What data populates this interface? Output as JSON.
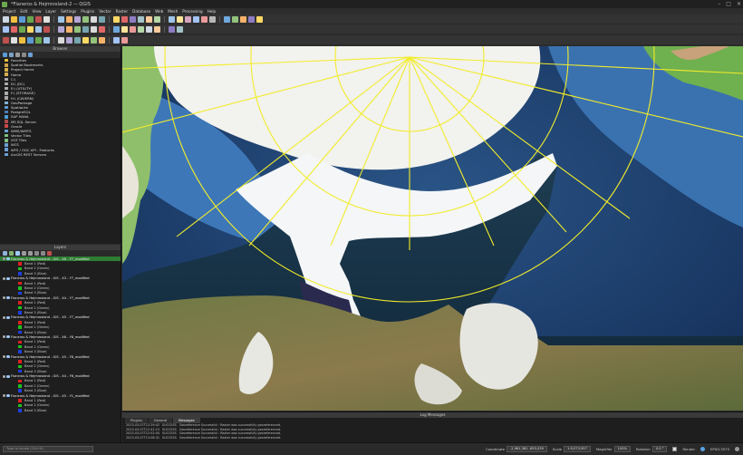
{
  "window": {
    "title": "*Flaneros & Hejmrosland-2 — QGIS"
  },
  "menu": [
    "Project",
    "Edit",
    "View",
    "Layer",
    "Settings",
    "Plugins",
    "Vector",
    "Raster",
    "Database",
    "Web",
    "Mesh",
    "Processing",
    "Help"
  ],
  "browser": {
    "title": "Browser",
    "items": [
      {
        "label": "Favorites",
        "icon": "star-icon",
        "color": "#e6c13a"
      },
      {
        "label": "Spatial Bookmarks",
        "icon": "bookmark-icon",
        "color": "#cfa44b"
      },
      {
        "label": "Project Home",
        "icon": "folder-icon",
        "color": "#d8b04e"
      },
      {
        "label": "Home",
        "icon": "folder-icon",
        "color": "#d8b04e"
      },
      {
        "label": "C:\\",
        "icon": "drive-icon",
        "color": "#aaaaaa"
      },
      {
        "label": "D:\\ (DC)",
        "icon": "drive-icon",
        "color": "#aaaaaa"
      },
      {
        "label": "E:\\ (UTILITY)",
        "icon": "drive-icon",
        "color": "#aaaaaa"
      },
      {
        "label": "F:\\ (STORAGE)",
        "icon": "drive-icon",
        "color": "#aaaaaa"
      },
      {
        "label": "H:\\ (CAVERN)",
        "icon": "drive-icon",
        "color": "#aaaaaa"
      },
      {
        "label": "GeoPackage",
        "icon": "geopackage-icon",
        "color": "#7fb3d5"
      },
      {
        "label": "SpatiaLite",
        "icon": "spatialite-icon",
        "color": "#5b9bd5"
      },
      {
        "label": "PostgreSQL",
        "icon": "postgresql-icon",
        "color": "#4a7ab5"
      },
      {
        "label": "SAP HANA",
        "icon": "sap-hana-icon",
        "color": "#4aa0d8"
      },
      {
        "label": "MS SQL Server",
        "icon": "mssql-icon",
        "color": "#b04a4a"
      },
      {
        "label": "Oracle",
        "icon": "oracle-icon",
        "color": "#c94a4a"
      },
      {
        "label": "WMS/WMTS",
        "icon": "wms-icon",
        "color": "#6aa0d8"
      },
      {
        "label": "Vector Tiles",
        "icon": "vector-tiles-icon",
        "color": "#7fbf7f"
      },
      {
        "label": "XYZ Tiles",
        "icon": "xyz-tiles-icon",
        "color": "#7fbf7f"
      },
      {
        "label": "WCS",
        "icon": "wcs-icon",
        "color": "#6aa0d8"
      },
      {
        "label": "WFS / OGC API - Features",
        "icon": "wfs-icon",
        "color": "#6aa0d8"
      },
      {
        "label": "ArcGIS REST Servers",
        "icon": "arcgis-icon",
        "color": "#6aa0d8"
      }
    ]
  },
  "layers": {
    "title": "Layers",
    "groups": [
      {
        "name": "Flaneros & Hejmrosland - GIS - X6 - Y7_modified",
        "selected": true
      },
      {
        "name": "Flaneros & Hejmrosland - GIS - X3 - Y7_modified",
        "selected": false
      },
      {
        "name": "Flaneros & Hejmrosland - GIS - X4 - Y7_modified",
        "selected": false
      },
      {
        "name": "Flaneros & Hejmrosland - GIS - X5 - Y7_modified",
        "selected": false
      },
      {
        "name": "Flaneros & Hejmrosland - GIS - X6 - Y8_modified",
        "selected": false
      },
      {
        "name": "Flaneros & Hejmrosland - GIS - X5 - Y8_modified",
        "selected": false
      },
      {
        "name": "Flaneros & Hejmrosland - GIS - X4 - Y8_modified",
        "selected": false
      },
      {
        "name": "Flaneros & Hejmrosland - GIS - X5 - Y1_modified",
        "selected": false
      }
    ],
    "bands": [
      {
        "label": "Band 1 (Red)",
        "color": "#e02020"
      },
      {
        "label": "Band 2 (Green)",
        "color": "#20c020"
      },
      {
        "label": "Band 3 (Blue)",
        "color": "#2040e0"
      }
    ]
  },
  "log": {
    "title": "Log Messages",
    "tabs": [
      "Plugins",
      "General",
      "Messages"
    ],
    "active_tab": "Messages",
    "lines": [
      {
        "time": "2023-03-07T12:29:42",
        "level": "SUCCESS",
        "text": "Georeference Successful : Raster was successfully georeferenced."
      },
      {
        "time": "2023-03-07T12:41:15",
        "level": "SUCCESS",
        "text": "Georeference Successful : Raster was successfully georeferenced."
      },
      {
        "time": "2023-03-07T12:52:04",
        "level": "SUCCESS",
        "text": "Georeference Successful : Raster was successfully georeferenced."
      },
      {
        "time": "2023-03-07T13:08:31",
        "level": "SUCCESS",
        "text": "Georeference Successful : Raster was successfully georeferenced."
      }
    ]
  },
  "status": {
    "locator_placeholder": "Type to locate (Ctrl+K)",
    "coordinate_label": "Coordinate",
    "coordinate_value": "-2,961,361 -655,039",
    "scale_label": "Scale",
    "scale_value": "1:9,073,957",
    "magnifier_label": "Magnifier",
    "magnifier_value": "100%",
    "rotation_label": "Rotation",
    "rotation_value": "0.0 °",
    "render_label": "Render",
    "crs_value": "EPSG:3575"
  }
}
